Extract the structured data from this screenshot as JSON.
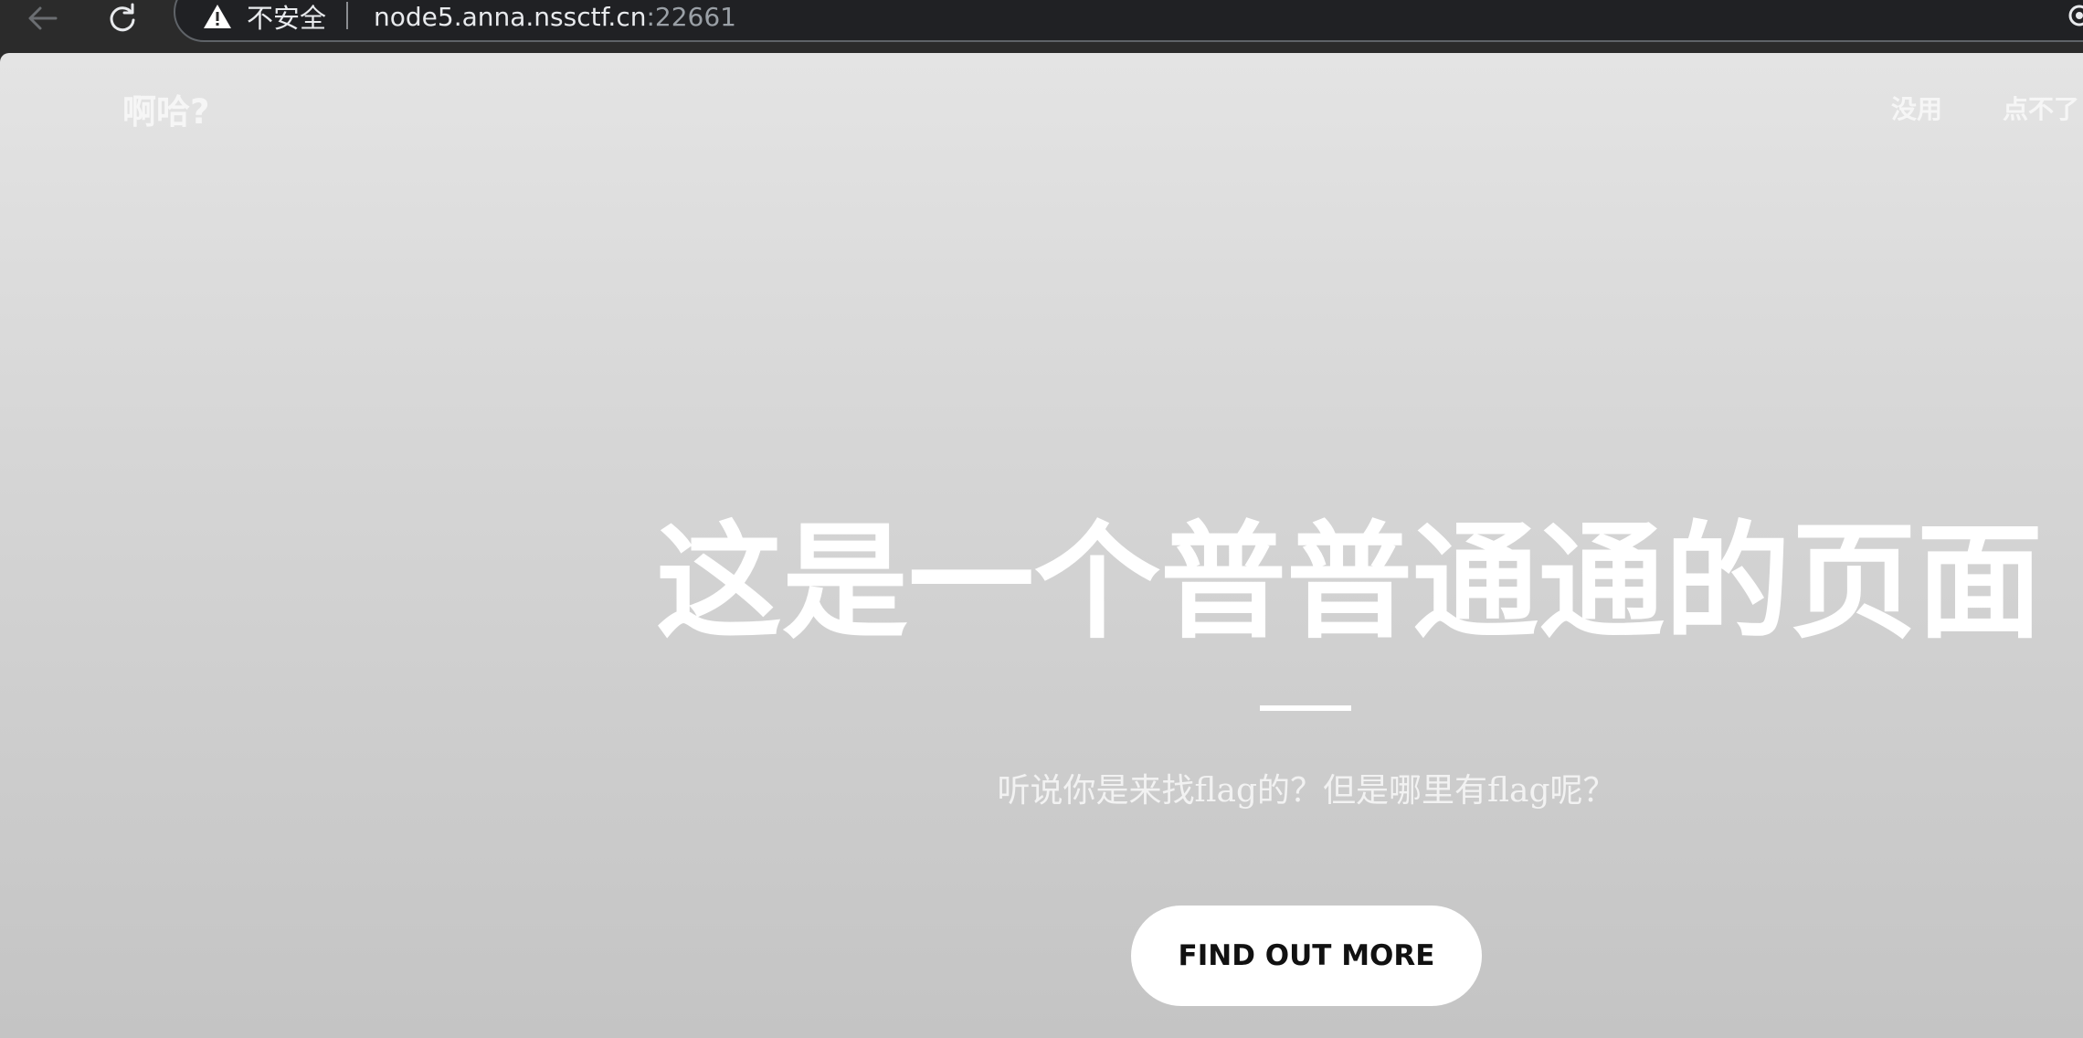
{
  "browser": {
    "security_label": "不安全",
    "url_host": "node5.anna.nssctf.cn",
    "url_port": ":22661",
    "icons": [
      "back-arrow-icon",
      "reload-icon",
      "warning-triangle-icon",
      "extension-icon"
    ]
  },
  "page": {
    "brand": "啊哈?",
    "nav": [
      "没用",
      "点不了"
    ],
    "hero": {
      "title": "这是一个普普通通的页面",
      "subtitle": "听说你是来找flag的？但是哪里有flag呢？",
      "cta_label": "FIND OUT MORE"
    },
    "colors": {
      "gradient_top": "#e4e4e4",
      "gradient_bottom": "#c4c4c4",
      "text": "#ffffff",
      "button_bg": "#ffffff",
      "button_text": "#111111"
    }
  }
}
